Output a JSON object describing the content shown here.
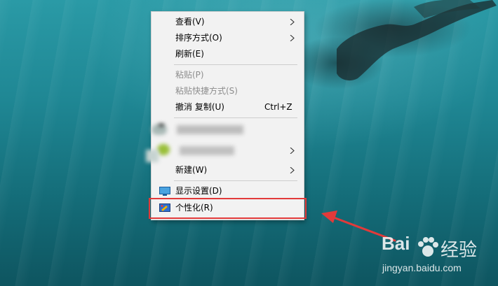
{
  "context_menu": {
    "items": [
      {
        "label": "查看(V)",
        "has_submenu": true,
        "enabled": true
      },
      {
        "label": "排序方式(O)",
        "has_submenu": true,
        "enabled": true
      },
      {
        "label": "刷新(E)",
        "has_submenu": false,
        "enabled": true
      },
      {
        "label": "粘贴(P)",
        "has_submenu": false,
        "enabled": false
      },
      {
        "label": "粘贴快捷方式(S)",
        "has_submenu": false,
        "enabled": false
      },
      {
        "label": "撤消 复制(U)",
        "shortcut": "Ctrl+Z",
        "has_submenu": false,
        "enabled": true
      },
      {
        "label": "新建(W)",
        "has_submenu": true,
        "enabled": true
      },
      {
        "label": "显示设置(D)",
        "icon": "display-settings-icon",
        "has_submenu": false,
        "enabled": true
      },
      {
        "label": "个性化(R)",
        "icon": "personalize-icon",
        "has_submenu": false,
        "enabled": true,
        "highlighted": true
      }
    ],
    "blurred_entries": 2
  },
  "annotation": {
    "highlight_color": "#e23a3a",
    "target": "个性化(R)"
  },
  "watermark": {
    "brand_a": "Bai",
    "brand_b": "经验",
    "url": "jingyan.baidu.com"
  },
  "colors": {
    "menu_bg": "#f2f2f2",
    "desktop": "#1f8794",
    "disabled_text": "#8d8d8d"
  }
}
